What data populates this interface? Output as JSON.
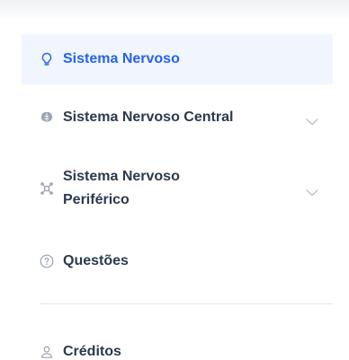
{
  "menu": {
    "items": [
      {
        "label": "Sistema Nervoso",
        "icon": "lightbulb-icon",
        "active": true,
        "expandable": false
      },
      {
        "label": "Sistema Nervoso Central",
        "icon": "brain-icon",
        "active": false,
        "expandable": true
      },
      {
        "label": "Sistema Nervoso Periférico",
        "icon": "network-icon",
        "active": false,
        "expandable": true
      },
      {
        "label": "Questões",
        "icon": "question-circle-icon",
        "active": false,
        "expandable": false
      }
    ],
    "footer_item": {
      "label": "Créditos",
      "icon": "user-icon"
    }
  },
  "colors": {
    "accent": "#2563eb",
    "text": "#2b3a4d",
    "icon_muted": "#9aa3ad",
    "active_bg": "#f1f5fe",
    "divider": "#e6e8eb"
  }
}
